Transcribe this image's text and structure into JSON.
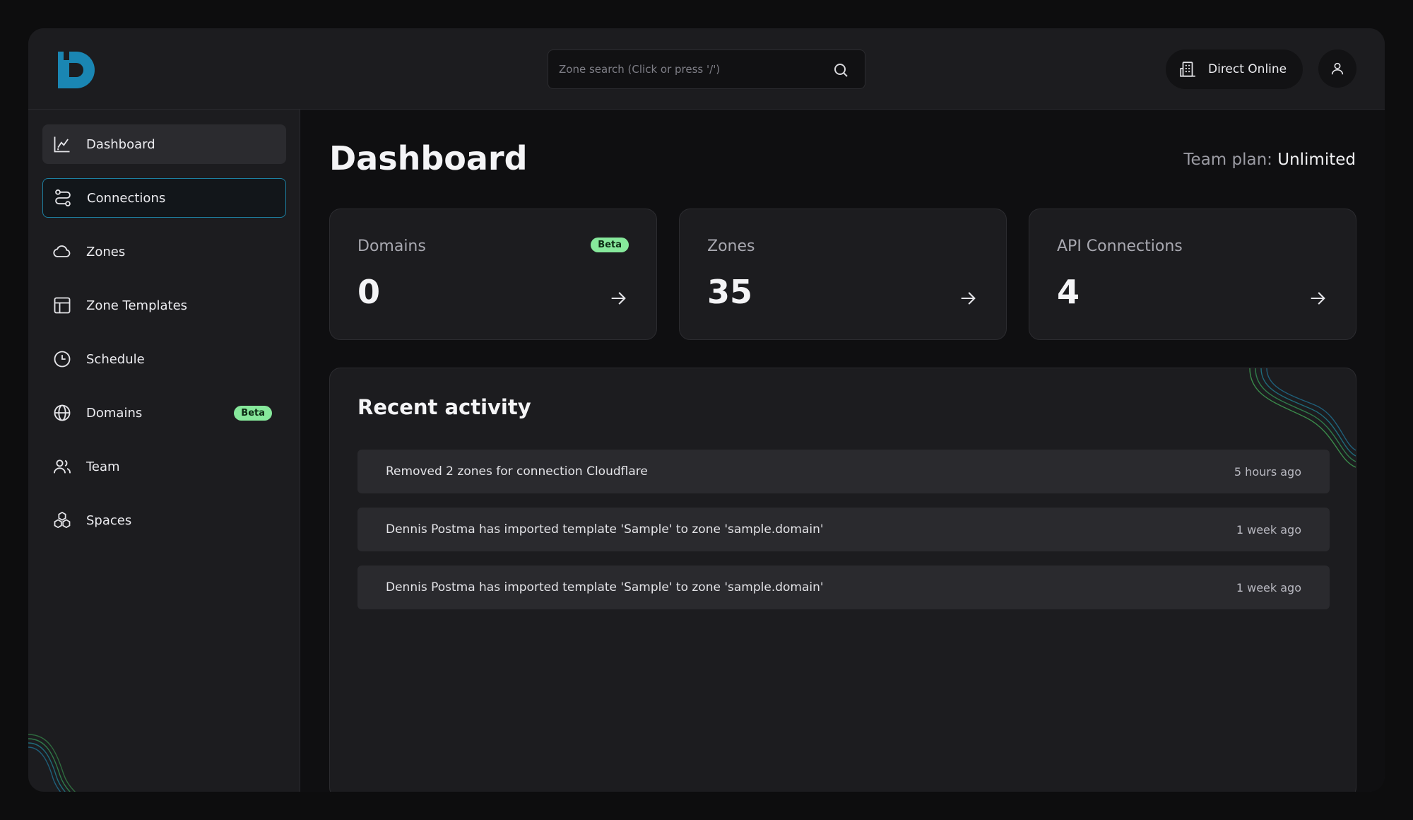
{
  "header": {
    "search_placeholder": "Zone search (Click or press '/')",
    "org_label": "Direct Online"
  },
  "sidebar": {
    "items": [
      {
        "label": "Dashboard",
        "icon": "chart-icon"
      },
      {
        "label": "Connections",
        "icon": "connections-icon"
      },
      {
        "label": "Zones",
        "icon": "cloud-icon"
      },
      {
        "label": "Zone Templates",
        "icon": "template-icon"
      },
      {
        "label": "Schedule",
        "icon": "clock-icon"
      },
      {
        "label": "Domains",
        "icon": "globe-icon",
        "badge": "Beta"
      },
      {
        "label": "Team",
        "icon": "users-icon"
      },
      {
        "label": "Spaces",
        "icon": "cubes-icon"
      }
    ],
    "footer_icons": [
      "docs-book-icon",
      "discord-icon",
      "mail-icon",
      "roadmap-icon",
      "moon-icon"
    ]
  },
  "main": {
    "title": "Dashboard",
    "team_plan_label": "Team plan:",
    "team_plan_value": "Unlimited",
    "cards": [
      {
        "label": "Domains",
        "value": "0",
        "badge": "Beta"
      },
      {
        "label": "Zones",
        "value": "35"
      },
      {
        "label": "API Connections",
        "value": "4"
      }
    ],
    "activity": {
      "title": "Recent activity",
      "rows": [
        {
          "text": "Removed 2 zones for connection Cloudflare",
          "time": "5 hours ago"
        },
        {
          "text": "Dennis Postma has imported template 'Sample' to zone 'sample.domain'",
          "time": "1 week ago"
        },
        {
          "text": "Dennis Postma has imported template 'Sample' to zone 'sample.domain'",
          "time": "1 week ago"
        }
      ]
    }
  },
  "colors": {
    "accent": "#1d7fa0",
    "badge": "#86e89b",
    "logo": "#1a86b3"
  }
}
